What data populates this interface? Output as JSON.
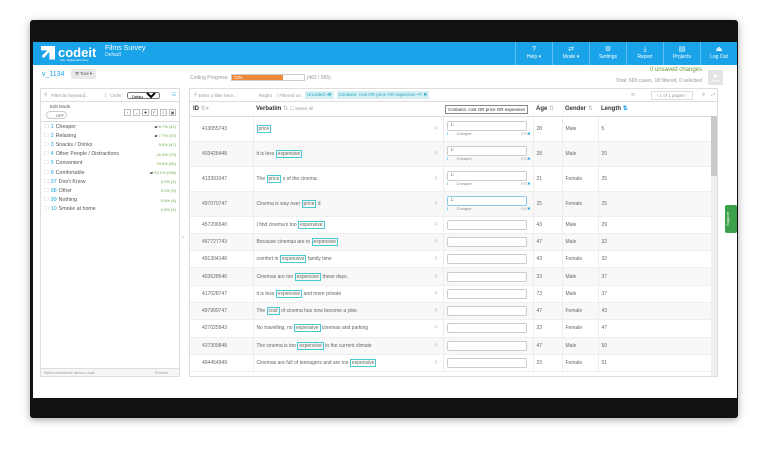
{
  "header": {
    "brand": "codeit",
    "tagline": "from digital taxonomy",
    "survey_title": "Films Survey",
    "survey_sub": "Default",
    "nav": [
      {
        "icon": "help-icon",
        "label": "Help ▾",
        "glyph": "?"
      },
      {
        "icon": "mode-icon",
        "label": "Mode ▾",
        "glyph": "⇄"
      },
      {
        "icon": "settings-icon",
        "label": "Settings",
        "glyph": "⚙"
      },
      {
        "icon": "report-icon",
        "label": "Report",
        "glyph": "⤓"
      },
      {
        "icon": "projects-icon",
        "label": "Projects",
        "glyph": "▤"
      },
      {
        "icon": "logout-icon",
        "label": "Log Out",
        "glyph": "⏏"
      }
    ]
  },
  "toolbar": {
    "variable": "v_1134",
    "tool_label": "⚒ Tool ▾",
    "progress_label": "Coding Progress:",
    "progress_pct": 72,
    "progress_text": "72%",
    "progress_count": "(482 / 665)",
    "unsaved": "0 unsaved changes",
    "totals": "Total: 665 cases, 18 filtered, 0 selected",
    "save_label": "Save"
  },
  "left": {
    "filter_placeholder": "Filter by keyword...",
    "order_label": "Order:",
    "order_value": "Default",
    "edit_mode": "Edit Mode",
    "toggle": "OFF",
    "codes": [
      {
        "n": "1",
        "label": "Cheaper",
        "pct": "8.7% (42)",
        "comment": true
      },
      {
        "n": "2",
        "label": "Relaxing",
        "pct": "7.7% (37)",
        "comment": true
      },
      {
        "n": "3",
        "label": "Snacks / Drinks",
        "pct": "9.8% (47)"
      },
      {
        "n": "4",
        "label": "Other People / Distractions",
        "pct": "16.4% (79)"
      },
      {
        "n": "5",
        "label": "Convenient",
        "pct": "19.5% (94)"
      },
      {
        "n": "6",
        "label": "Comfortable",
        "pct": "53.1% (256)",
        "comment": true
      },
      {
        "n": "97",
        "label": "Don't Know",
        "pct": "0.0% (4)"
      },
      {
        "n": "98",
        "label": "Other",
        "pct": "0.0% (0)"
      },
      {
        "n": "99",
        "label": "Nothing",
        "pct": "0.8% (4)"
      },
      {
        "n": "10",
        "label": "Smoke at home",
        "pct": "0.8% (4)"
      }
    ],
    "footer": "Select code/theme items to code",
    "count": "10 Items"
  },
  "main": {
    "filter_placeholder": "Enter a filter here...",
    "regex": "RegEx",
    "filtered_on": "Filtered on:",
    "chip1": "Uncoded",
    "chip2": "Contains: cost OR price OR expensive",
    "tooltip": "Contains: cost OR price OR expensive",
    "pages": "‹ 1 of 1 pages ›",
    "columns": {
      "id": "ID",
      "verbatim": "Verbatim",
      "select_all": "Select all",
      "age": "Age",
      "gender": "Gender",
      "length": "Length"
    },
    "rows": [
      {
        "id": "413055743",
        "pre": "",
        "kw": "price",
        "post": "",
        "code": "1:",
        "code_num": "1",
        "code_label": "Cheaper",
        "age": "28",
        "gender": "Male",
        "length": "5"
      },
      {
        "id": "403428448",
        "pre": "it is less ",
        "kw": "expensive",
        "post": "",
        "code": "1:",
        "code_num": "1",
        "code_label": "Cheaper",
        "age": "28",
        "gender": "Male",
        "length": "20"
      },
      {
        "id": "413391047",
        "pre": "The ",
        "kw": "price",
        "post": " s of the cinema.",
        "code": "1:",
        "code_num": "1",
        "code_label": "Cheaper",
        "age": "21",
        "gender": "Female",
        "length": "25"
      },
      {
        "id": "497070747",
        "pre": "Cinema is way over ",
        "kw": "price",
        "post": " d",
        "code": "1:",
        "code_num": "1",
        "code_label": "Cheaper",
        "age": "25",
        "gender": "Female",
        "length": "25"
      },
      {
        "id": "457206540",
        "pre": "I find cinema's too ",
        "kw": "expensive",
        "post": "",
        "age": "43",
        "gender": "Male",
        "length": "29"
      },
      {
        "id": "467727743",
        "pre": "Because cinemas are to ",
        "kw": "expensive",
        "post": "",
        "age": "47",
        "gender": "Male",
        "length": "32"
      },
      {
        "id": "491304146",
        "pre": "comfort in ",
        "kw": "expensive",
        "post": " family time",
        "age": "43",
        "gender": "Female",
        "length": "32"
      },
      {
        "id": "403628546",
        "pre": "Cinemas are too ",
        "kw": "expensive",
        "post": " these days.",
        "age": "33",
        "gender": "Male",
        "length": "37"
      },
      {
        "id": "417028747",
        "pre": "it is less ",
        "kw": "expensive",
        "post": " and more private",
        "age": "73",
        "gender": "Male",
        "length": "37"
      },
      {
        "id": "497999747",
        "pre": "The ",
        "kw": "cost",
        "post": " of cinema has now become a joke.",
        "age": "47",
        "gender": "Female",
        "length": "43"
      },
      {
        "id": "427025943",
        "pre": "No travelling, no ",
        "kw": "expensive",
        "post": " cinemas and parking",
        "age": "23",
        "gender": "Female",
        "length": "47"
      },
      {
        "id": "437309848",
        "pre": "The cinema is too ",
        "kw": "expensive",
        "post": " in the current climate",
        "age": "47",
        "gender": "Male",
        "length": "50"
      },
      {
        "id": "494454949",
        "pre": "Cinemas are full of teenagers and are too ",
        "kw": "expensive",
        "post": "",
        "age": "23",
        "gender": "Female",
        "length": "51"
      }
    ]
  },
  "support": "Support",
  "colors": {
    "header": "#1aa3e8",
    "progress": "#f0883a",
    "keyword": "#4cc9d0",
    "support": "#3aa04a"
  }
}
